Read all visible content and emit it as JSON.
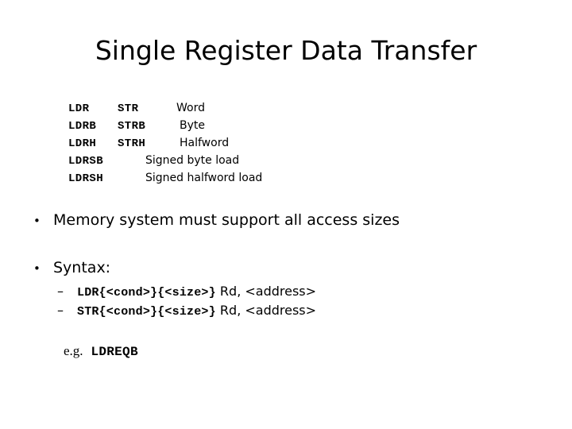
{
  "slide": {
    "title": "Single Register Data Transfer",
    "background_color": "#ffffff",
    "text_color": "#000000"
  },
  "instruction_table": {
    "rows": [
      {
        "load": "LDR",
        "store": "STR",
        "description": "Word"
      },
      {
        "load": "LDRB",
        "store": "STRB",
        "description": "Byte"
      },
      {
        "load": "LDRH",
        "store": "STRH",
        "description": "Halfword"
      },
      {
        "load": "LDRSB",
        "store": "",
        "description": "Signed byte load"
      },
      {
        "load": "LDRSH",
        "store": "",
        "description": "Signed halfword load"
      }
    ]
  },
  "bullets": [
    {
      "marker": "•",
      "text": "Memory system must support all access sizes"
    },
    {
      "marker": "•",
      "text": "Syntax:"
    }
  ],
  "sub_bullets": [
    {
      "marker": "–",
      "code": "LDR{<cond>}{<size>}",
      "operands": " Rd, <address>"
    },
    {
      "marker": "–",
      "code": "STR{<cond>}{<size>}",
      "operands": " Rd, <address>"
    }
  ],
  "example": {
    "label": "e.g.",
    "code": "LDREQB"
  }
}
